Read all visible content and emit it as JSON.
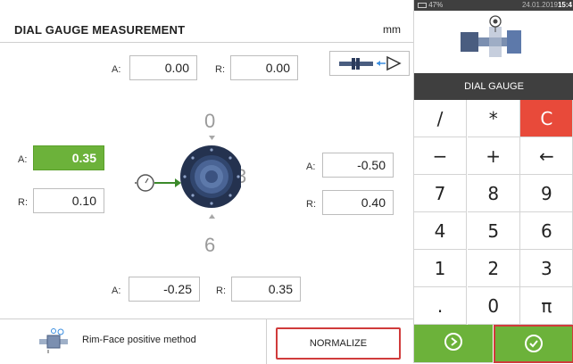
{
  "header": {
    "title": "DIAL GAUGE MEASUREMENT",
    "unit": "mm"
  },
  "clock_labels": {
    "top": "0",
    "right": "3",
    "bottom": "6"
  },
  "top": {
    "a_label": "A:",
    "a_value": "0.00",
    "r_label": "R:",
    "r_value": "0.00"
  },
  "left": {
    "a_label": "A:",
    "a_value": "0.35",
    "r_label": "R:",
    "r_value": "0.10"
  },
  "right": {
    "a_label": "A:",
    "a_value": "-0.50",
    "r_label": "R:",
    "r_value": "0.40"
  },
  "bottom": {
    "a_label": "A:",
    "a_value": "-0.25",
    "r_label": "R:",
    "r_value": "0.35"
  },
  "footer": {
    "method": "Rim-Face positive method",
    "normalize": "NORMALIZE"
  },
  "status": {
    "battery": "47%",
    "date": "24.01.2019",
    "time": "15:4"
  },
  "panel": {
    "gauge_label": "DIAL GAUGE"
  },
  "keypad": [
    "/",
    "*",
    "C",
    "−",
    "+",
    "←",
    "7",
    "8",
    "9",
    "4",
    "5",
    "6",
    "1",
    "2",
    "3",
    ".",
    "0",
    "π"
  ],
  "colors": {
    "active_field": "#6cb23a",
    "clear_key": "#e84a3a",
    "action_key": "#6cb23a",
    "highlight": "#d03b3b",
    "panel_dark": "#3f3f3f"
  }
}
